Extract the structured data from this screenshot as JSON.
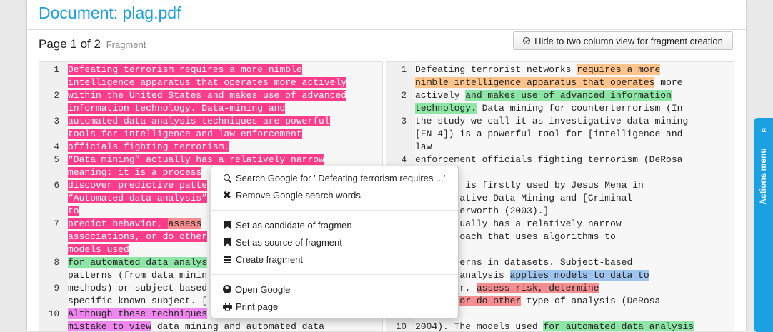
{
  "header": {
    "title": "Document: plag.pdf",
    "page_indicator": "Page 1 of 2",
    "page_sub": "Fragment",
    "view_button": "Hide to two column view for fragment creation"
  },
  "left_lines": [
    {
      "n": "1",
      "segs": [
        {
          "t": "Defeating terrorism requires a more nimble",
          "c": "pink"
        }
      ]
    },
    {
      "n": "",
      "segs": [
        {
          "t": "intelligence apparatus that operates more actively",
          "c": "pink"
        }
      ]
    },
    {
      "n": "2",
      "segs": [
        {
          "t": "within the United States and makes use of advanced",
          "c": "pink"
        }
      ]
    },
    {
      "n": "",
      "segs": [
        {
          "t": "information technology. Data-mining and",
          "c": "pink"
        }
      ]
    },
    {
      "n": "3",
      "segs": [
        {
          "t": "automated data-analysis techniques are powerful",
          "c": "pink"
        }
      ]
    },
    {
      "n": "",
      "segs": [
        {
          "t": "tools for intelligence and law enforcement",
          "c": "pink"
        }
      ]
    },
    {
      "n": "4",
      "segs": [
        {
          "t": "officials fighting terrorism.",
          "c": "pink"
        }
      ]
    },
    {
      "n": "5",
      "segs": [
        {
          "t": "“Data mining” actually has a relatively narrow",
          "c": "pink"
        }
      ]
    },
    {
      "n": "",
      "segs": [
        {
          "t": "meaning: it is a process",
          "c": "pink"
        }
      ]
    },
    {
      "n": "6",
      "segs": [
        {
          "t": "discover predictive patte",
          "c": "pink"
        }
      ]
    },
    {
      "n": "",
      "segs": [
        {
          "t": "“Automated data analysis”",
          "c": "pink"
        }
      ]
    },
    {
      "n": "",
      "segs": [
        {
          "t": "to",
          "c": "pink"
        }
      ]
    },
    {
      "n": "7",
      "segs": [
        {
          "t": "predict behavior, ",
          "c": "pink"
        },
        {
          "t": "assess",
          "c": "red"
        }
      ]
    },
    {
      "n": "",
      "segs": [
        {
          "t": "associations, or do other",
          "c": "pink"
        }
      ]
    },
    {
      "n": "",
      "segs": [
        {
          "t": "models used",
          "c": "pink"
        }
      ]
    },
    {
      "n": "8",
      "segs": [
        {
          "t": "for automated data analys",
          "c": "green"
        }
      ]
    },
    {
      "n": "",
      "segs": [
        {
          "t": "patterns (from data minin",
          "c": ""
        }
      ]
    },
    {
      "n": "9",
      "segs": [
        {
          "t": "methods) or subject based",
          "c": ""
        }
      ]
    },
    {
      "n": "",
      "segs": [
        {
          "t": "specific known subject. [",
          "c": ""
        }
      ]
    },
    {
      "n": "10",
      "segs": [
        {
          "t": "Although these techniques",
          "c": "violet"
        }
      ]
    },
    {
      "n": "",
      "segs": [
        {
          "t": "mistake to view",
          "c": "violet"
        },
        {
          "t": " data mining and automated data",
          "c": ""
        }
      ]
    }
  ],
  "right_lines": [
    {
      "n": "1",
      "segs": [
        {
          "t": "Defeating terrorist networks ",
          "c": ""
        },
        {
          "t": "requires a more",
          "c": "orange"
        }
      ]
    },
    {
      "n": "",
      "segs": [
        {
          "t": "nimble intelligence apparatus that operates",
          "c": "orange"
        },
        {
          "t": " more",
          "c": ""
        }
      ]
    },
    {
      "n": "2",
      "segs": [
        {
          "t": "actively ",
          "c": ""
        },
        {
          "t": "and makes use of advanced information",
          "c": "green"
        }
      ]
    },
    {
      "n": "",
      "segs": [
        {
          "t": "technology.",
          "c": "green"
        },
        {
          "t": " Data mining for counterterrorism (In",
          "c": ""
        }
      ]
    },
    {
      "n": "3",
      "segs": [
        {
          "t": "the study we call it as investigative data mining",
          "c": ""
        }
      ]
    },
    {
      "n": "",
      "segs": [
        {
          "t": "[FN 4]) is a powerful tool for [intelligence and",
          "c": ""
        }
      ]
    },
    {
      "n": "",
      "segs": [
        {
          "t": "law",
          "c": ""
        }
      ]
    },
    {
      "n": "4",
      "segs": [
        {
          "t": "enforcement officials fighting terrorism (DeRosa",
          "c": ""
        }
      ]
    },
    {
      "n": "",
      "segs": [
        {
          "t": "2004).]",
          "c": ""
        }
      ]
    },
    {
      "n": "",
      "segs": [
        {
          "t": "The term is firstly used by Jesus Mena in",
          "c": ""
        }
      ]
    },
    {
      "n": "",
      "segs": [
        {
          "t": "Investigative Data Mining and [Criminal",
          "c": ""
        }
      ]
    },
    {
      "n": "",
      "segs": [
        {
          "t": "on, Butterworth (2003).]",
          "c": ""
        }
      ]
    },
    {
      "n": "",
      "segs": [
        {
          "t": "ning actually has a relatively narrow",
          "c": ""
        }
      ]
    },
    {
      "n": "",
      "segs": [
        {
          "t": "the approach that uses algorithms to",
          "c": ""
        }
      ]
    },
    {
      "n": "",
      "segs": [
        {
          "t": "ne",
          "c": ""
        }
      ]
    },
    {
      "n": "",
      "segs": [
        {
          "t": "cal patterns in datasets. Subject-based",
          "c": ""
        }
      ]
    },
    {
      "n": "",
      "segs": [
        {
          "t": "ed data analysis ",
          "c": ""
        },
        {
          "t": "applies models to data to",
          "c": "blue"
        }
      ]
    },
    {
      "n": "",
      "segs": [
        {
          "t": "behaviour, ",
          "c": ""
        },
        {
          "t": "assess risk, determine",
          "c": "red"
        }
      ]
    },
    {
      "n": "",
      "segs": [
        {
          "t": "ations, or do other",
          "c": "red"
        },
        {
          "t": " type of analysis (DeRosa",
          "c": ""
        }
      ]
    },
    {
      "n": "",
      "segs": [
        {
          "t": "",
          "c": ""
        }
      ]
    },
    {
      "n": "10",
      "segs": [
        {
          "t": "2004). The models used ",
          "c": ""
        },
        {
          "t": "for automated data analysis",
          "c": "green"
        }
      ]
    }
  ],
  "context_menu": {
    "search_google": "Search Google for ' Defeating terrorism requires ...'",
    "remove_words": "Remove Google search words",
    "set_candidate": "Set as candidate of fragmen",
    "set_source": "Set as source of fragment",
    "create_fragment": "Create fragment",
    "open_google": "Open Google",
    "print_page": "Print page"
  },
  "actions_menu": {
    "chevron": "«",
    "label": "Actions menu"
  },
  "colors": {
    "accent": "#1ba1e2",
    "pink": "#ff3d8a",
    "orange": "#ffc48c",
    "green": "#8ee6a6",
    "blue": "#9fc5ef",
    "red": "#f38d8f",
    "violet": "#ee88ee"
  }
}
